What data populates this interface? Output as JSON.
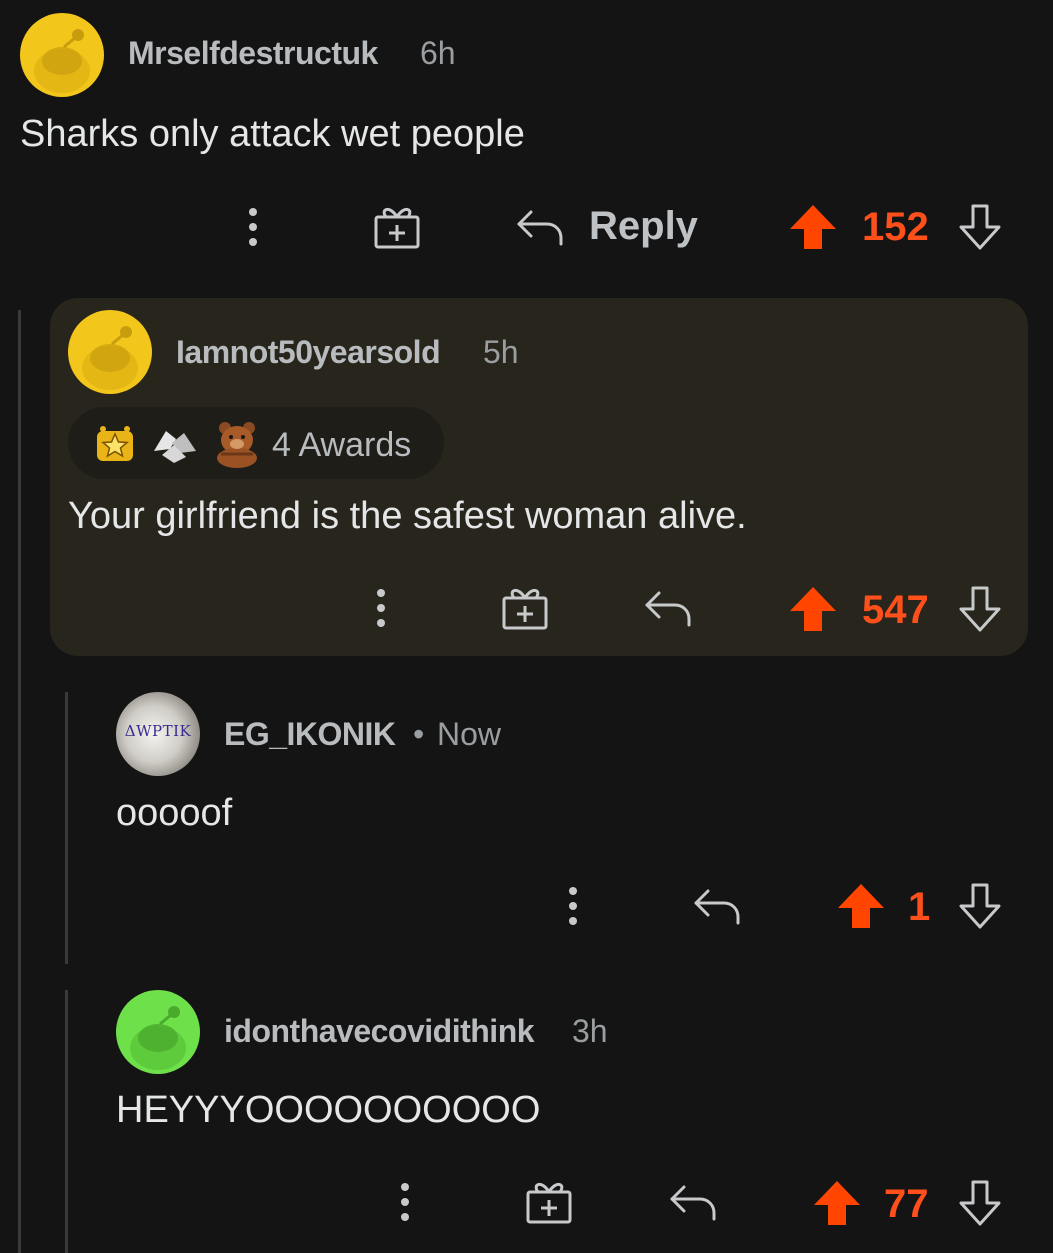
{
  "colors": {
    "background": "#141414",
    "upvote": "#ff4500",
    "score": "#ff4f1a",
    "highlight": "#27251c"
  },
  "comments": [
    {
      "username": "Mrselfdestructuk",
      "time": "6h",
      "body": "Sharks only attack wet people",
      "score": "152",
      "reply_label": "Reply",
      "avatar_color": "#f2c61b"
    },
    {
      "username": "Iamnot50yearsold",
      "time": "5h",
      "awards_label": "4 Awards",
      "body": "Your girlfriend is the safest woman alive.",
      "score": "547",
      "avatar_color": "#f2c61b"
    },
    {
      "username": "EG_IKONIK",
      "separator": "•",
      "time": "Now",
      "avatar_text": "ΔWPTIK",
      "body": "ooooof",
      "score": "1"
    },
    {
      "username": "idonthavecovidithink",
      "time": "3h",
      "body": "HEYYYOOOOOOOOOO",
      "score": "77",
      "avatar_color": "#6ee04a"
    }
  ],
  "icons": {
    "more": "more-vertical-icon",
    "award": "gift-award-icon",
    "reply": "reply-arrow-icon",
    "upvote": "upvote-arrow-icon",
    "downvote": "downvote-arrow-icon"
  }
}
